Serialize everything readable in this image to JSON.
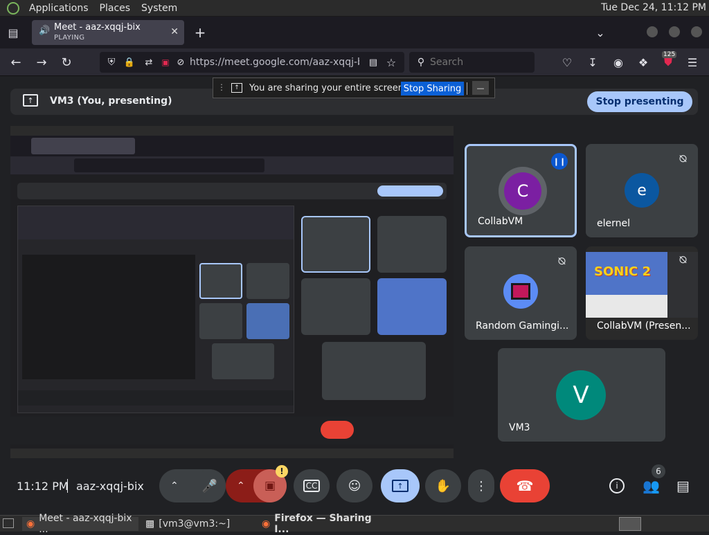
{
  "top_panel": {
    "menus": [
      "Applications",
      "Places",
      "System"
    ],
    "clock": "Tue Dec 24, 11:12 PM"
  },
  "browser": {
    "tab": {
      "title": "Meet - aaz-xqqj-bix",
      "status": "PLAYING"
    },
    "url": "https://meet.google.com/aaz-xqqj-bix/",
    "search_placeholder": "Search",
    "extension_badge": "125"
  },
  "share_notice": {
    "text": "You are sharing your entire screen.",
    "stop_label": "Stop Sharing",
    "minimize_label": "—"
  },
  "present_bar": {
    "label": "VM3 (You, presenting)",
    "stop_label": "Stop presenting"
  },
  "tiles": [
    {
      "name": "CollabVM",
      "initial": "C",
      "avatar_color": "#7b1fa2",
      "speaking": true
    },
    {
      "name": "elernel",
      "initial": "e",
      "avatar_color": "#0b57a0",
      "muted": true
    },
    {
      "name": "Random Gamingi...",
      "muted": true
    },
    {
      "name": "CollabVM (Presen...",
      "muted": true,
      "content_label": "SONIC 2"
    },
    {
      "name": "VM3",
      "initial": "V",
      "avatar_color": "#00897b"
    }
  ],
  "controls": {
    "time": "11:12 PM",
    "meeting_code": "aaz-xqqj-bix",
    "participant_count": "6",
    "camera_warning": "!"
  },
  "taskbar": {
    "items": [
      "Meet - aaz-xqqj-bix ...",
      "[vm3@vm3:~]",
      "Firefox — Sharing I..."
    ]
  },
  "colors": {
    "accent_blue": "#a8c7fa",
    "hangup_red": "#e94235",
    "present_blue": "#a8c7fa",
    "cam_off_red": "#8c1d18"
  }
}
